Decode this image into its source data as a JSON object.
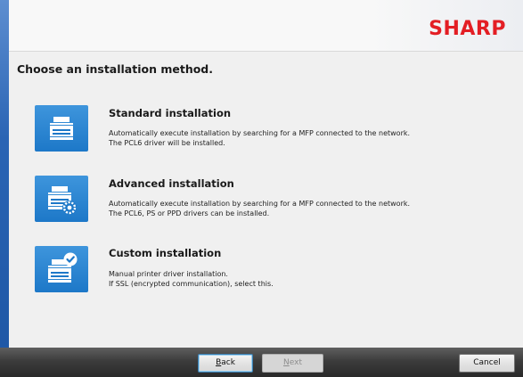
{
  "brand": {
    "logo_text": "SHARP",
    "logo_color": "#e31e24"
  },
  "page": {
    "heading": "Choose an installation method."
  },
  "options": [
    {
      "title": "Standard installation",
      "desc_line1": "Automatically execute installation by searching for a MFP connected to the network.",
      "desc_line2": "The PCL6 driver will be installed.",
      "icon": "printer-icon"
    },
    {
      "title": "Advanced installation",
      "desc_line1": "Automatically execute installation by searching for a MFP connected to the network.",
      "desc_line2": "The PCL6, PS or PPD drivers can be installed.",
      "icon": "printer-gear-icon"
    },
    {
      "title": "Custom installation",
      "desc_line1": "Manual printer driver installation.",
      "desc_line2": "If SSL (encrypted communication), select this.",
      "icon": "printer-check-icon"
    }
  ],
  "footer": {
    "back_accel": "B",
    "back_rest": "ack",
    "next_accel": "N",
    "next_rest": "ext",
    "cancel_label": "Cancel"
  },
  "colors": {
    "accent_blue": "#1d78c8",
    "side_bar": "#1f58a6"
  }
}
